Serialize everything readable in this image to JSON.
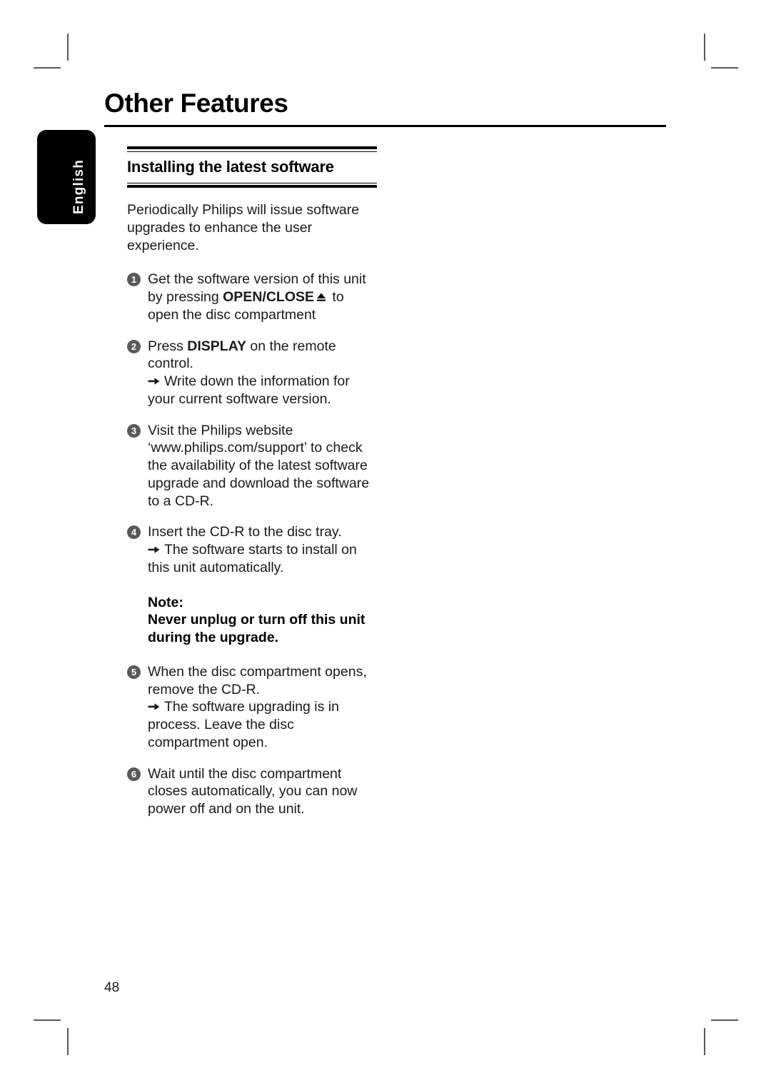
{
  "language_tab": {
    "label": "English"
  },
  "header": {
    "title": "Other Features"
  },
  "section": {
    "title": "Installing the latest software",
    "intro": "Periodically Philips will issue software upgrades to enhance the user experience."
  },
  "steps": [
    {
      "number": "1",
      "text_before": "Get the software version of this unit by pressing ",
      "bold": "OPEN/CLOSE",
      "icon": "eject-icon",
      "text_after": " to open the disc compartment",
      "result": ""
    },
    {
      "number": "2",
      "text_before": "Press ",
      "bold": "DISPLAY",
      "icon": "",
      "text_after": " on the remote control.",
      "result": "Write down the information for your current software version."
    },
    {
      "number": "3",
      "text_before": "Visit the Philips website ‘www.philips.com/support’ to check the availability of the latest software upgrade and download the software to a CD-R.",
      "bold": "",
      "icon": "",
      "text_after": "",
      "result": ""
    },
    {
      "number": "4",
      "text_before": "Insert the CD-R to the disc tray.",
      "bold": "",
      "icon": "",
      "text_after": "",
      "result": "The software starts to install on this unit automatically."
    }
  ],
  "note": {
    "label": "Note:",
    "body": "Never unplug or turn off this unit during the upgrade."
  },
  "steps_after_note": [
    {
      "number": "5",
      "text_before": "When the disc compartment opens, remove the CD-R.",
      "bold": "",
      "icon": "",
      "text_after": "",
      "result": "The software upgrading is in process. Leave the disc compartment open."
    },
    {
      "number": "6",
      "text_before": "Wait until the disc compartment closes automatically, you can now power off and on the unit.",
      "bold": "",
      "icon": "",
      "text_after": "",
      "result": ""
    }
  ],
  "footer": {
    "page_number": "48"
  },
  "colors": {
    "marker_gray": "#595959",
    "rule_black": "#000000",
    "tab_black": "#000000",
    "crop_mark": "#58585a"
  }
}
